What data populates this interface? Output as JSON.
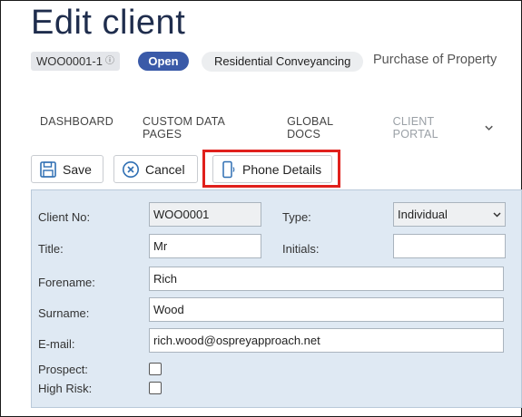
{
  "header": {
    "title": "Edit client",
    "ref": "WOO0001-1",
    "status": "Open",
    "matter_type": "Residential Conveyancing",
    "matter_description": "Purchase of Property"
  },
  "nav": {
    "items": [
      "DASHBOARD",
      "CUSTOM DATA PAGES",
      "GLOBAL DOCS"
    ],
    "portal": "CLIENT PORTAL"
  },
  "toolbar": {
    "save_label": "Save",
    "cancel_label": "Cancel",
    "phone_label": "Phone Details"
  },
  "form": {
    "client_no_label": "Client No:",
    "client_no_value": "WOO0001",
    "type_label": "Type:",
    "type_value": "Individual",
    "title_label": "Title:",
    "title_value": "Mr",
    "initials_label": "Initials:",
    "initials_value": "",
    "forename_label": "Forename:",
    "forename_value": "Rich",
    "surname_label": "Surname:",
    "surname_value": "Wood",
    "email_label": "E-mail:",
    "email_value": "rich.wood@ospreyapproach.net",
    "prospect_label": "Prospect:",
    "prospect_checked": false,
    "high_risk_label": "High Risk:",
    "high_risk_checked": false
  },
  "colors": {
    "status_pill": "#3a5aa8",
    "icon_blue": "#2f6fb3",
    "highlight": "#e0201c",
    "panel": "#dfe9f3"
  }
}
